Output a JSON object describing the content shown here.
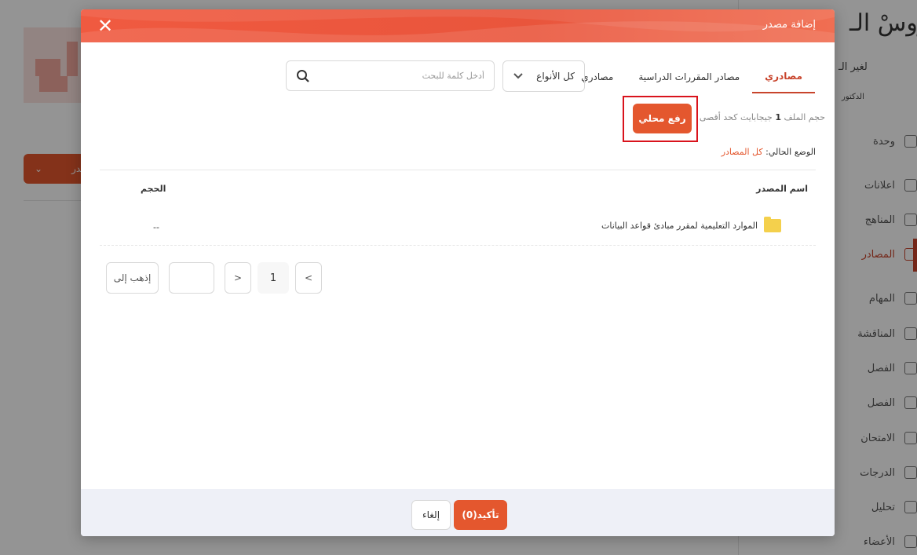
{
  "background": {
    "logo": "دُروسْ الـ",
    "logo_sub": "لغير الـ",
    "logo_sub2": "الدكتور",
    "dropdown_label": "مصدر",
    "sidebar": [
      {
        "label": "وحدة",
        "icon": "sort-icon"
      },
      {
        "label": "اعلانات",
        "icon": "bell-icon"
      },
      {
        "label": "المناهج",
        "icon": "book-icon"
      },
      {
        "label": "المصادر",
        "icon": "folder-icon",
        "active": true
      },
      {
        "label": "المهام",
        "icon": "shield-icon"
      },
      {
        "label": "المناقشة",
        "icon": "chat-icon"
      },
      {
        "label": "الفصل",
        "icon": "user-icon"
      },
      {
        "label": "الفصل",
        "icon": "video-icon"
      },
      {
        "label": "الامتحان",
        "icon": "exam-icon"
      },
      {
        "label": "الدرجات",
        "icon": "search-doc-icon"
      },
      {
        "label": "تحليل",
        "icon": "chart-icon"
      },
      {
        "label": "الأعضاء",
        "icon": "members-icon"
      }
    ]
  },
  "modal": {
    "title": "إضافة مصدر",
    "close_icon": "✕",
    "tabs": [
      {
        "label": "مصادري",
        "active": true
      },
      {
        "label": "مصادر المقررات الدراسية",
        "active": false
      },
      {
        "label": "مصادري",
        "active": false
      }
    ],
    "type_select": {
      "value": "كل الأنواع"
    },
    "search": {
      "placeholder": "أدخل كلمة للبحث",
      "value": ""
    },
    "size_note": {
      "prefix": "حجم الملف",
      "number": "1",
      "suffix": "جيجابايت كحد أقصى"
    },
    "upload_button": "رفع محلي",
    "location": {
      "label": "الوضع الحالي:",
      "link": "كل المصادر"
    },
    "table": {
      "headers": {
        "name": "اسم المصدر",
        "size": "الحجم"
      },
      "rows": [
        {
          "name": "الموارد التعليمية لمقرر مبادئ قواعد البيانات",
          "size": "--"
        }
      ]
    },
    "pagination": {
      "prev": "<",
      "current_page": "1",
      "next": ">",
      "goto_value": "",
      "goto_label": "إذهب إلى"
    },
    "footer": {
      "confirm": "تأكيد(0)",
      "cancel": "إلغاء"
    }
  },
  "colors": {
    "accent": "#e4572e",
    "header": "#ee5a3f",
    "highlight": "#d9131c",
    "footer_bg": "#eef0f7"
  }
}
